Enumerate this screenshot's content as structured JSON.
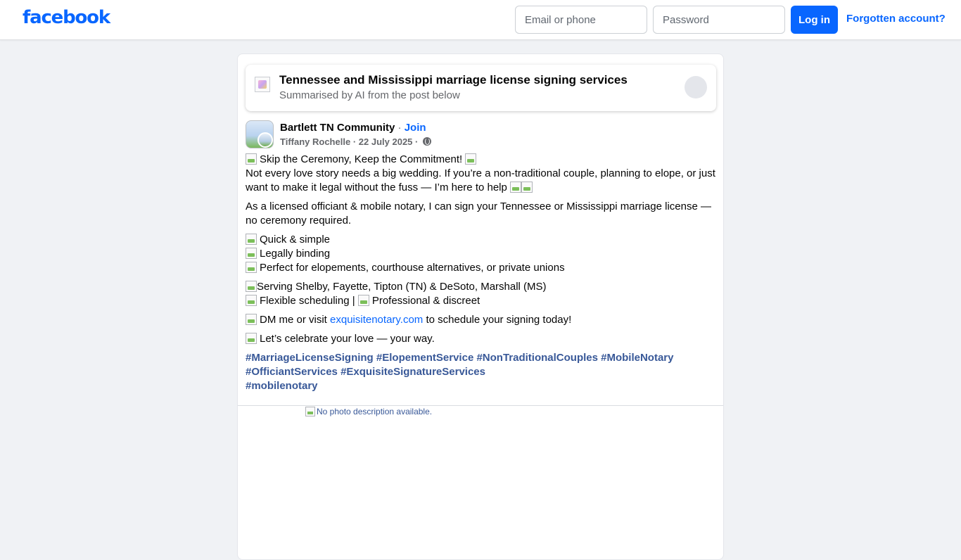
{
  "header": {
    "logo": "facebook",
    "email_placeholder": "Email or phone",
    "password_placeholder": "Password",
    "login_label": "Log in",
    "forgot_label": "Forgotten account?"
  },
  "ai_summary": {
    "title": "Tennessee and Mississippi marriage license signing services",
    "subtitle": "Summarised by AI from the post below"
  },
  "post_header": {
    "group": "Bartlett TN Community",
    "separator": "·",
    "join": "Join",
    "author": "Tiffany Rochelle",
    "date": "22 July 2025"
  },
  "post_body": {
    "l1": "Skip the Ceremony, Keep the Commitment!",
    "l2": "Not every love story needs a big wedding. If you’re a non-traditional couple, planning to elope, or just want to make it legal without the fuss — I’m here to help",
    "p2": "As a licensed officiant & mobile notary, I can sign your Tennessee or Mississippi marriage license — no ceremony required.",
    "b1": "Quick & simple",
    "b2": "Legally binding",
    "b3": "Perfect for elopements, courthouse alternatives, or private unions",
    "s1": "Serving Shelby, Fayette, Tipton (TN) & DeSoto, Marshall (MS)",
    "s2a": "Flexible scheduling |",
    "s2b": "Professional & discreet",
    "dm_pre": "DM me or visit",
    "dm_link": "exquisitenotary.com",
    "dm_post": "to schedule your signing today!",
    "celebrate": "Let’s celebrate your love — your way.",
    "tags_line1": "#MarriageLicenseSigning #ElopementService #NonTraditionalCouples #MobileNotary",
    "tags_line2": "#OfficiantServices #ExquisiteSignatureServices",
    "tags_line3": "#mobilenotary"
  },
  "photo": {
    "alt": "No photo description available."
  },
  "colors": {
    "brand": "#0866ff",
    "background": "#f0f2f5",
    "hashtag": "#385898"
  }
}
